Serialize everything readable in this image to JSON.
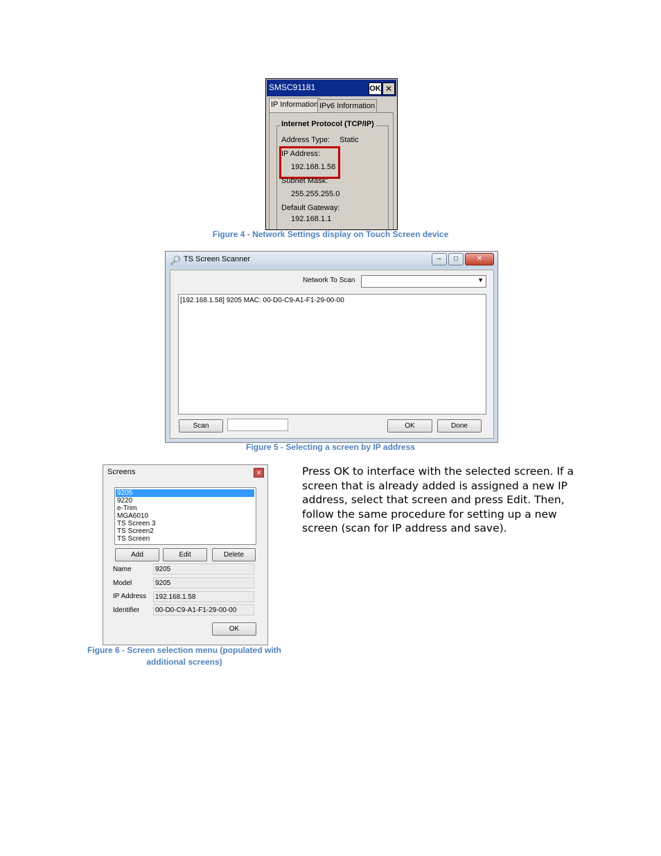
{
  "figure4": {
    "window_title": "SMSC91181",
    "ok_label": "OK",
    "close_label": "✕",
    "tabs": [
      "IP Information",
      "IPv6 Information"
    ],
    "group_title": "Internet Protocol (TCP/IP)",
    "address_type_label": "Address Type:",
    "address_type_value": "Static",
    "ip_address_label": "IP Address:",
    "ip_address_value": "192.168.1.58",
    "subnet_label": "Subnet Mask:",
    "subnet_value": "255.255.255.0",
    "gateway_label": "Default Gateway:",
    "gateway_value": "192.168.1.1",
    "caption": "Figure 4 - Network Settings display on Touch Screen device",
    "highlight_color": "#c00000"
  },
  "figure5": {
    "window_title": "TS Screen Scanner",
    "network_label": "Network To Scan",
    "network_value": "",
    "list_rows": [
      "[192.168.1.58] 9205 MAC: 00-D0-C9-A1-F1-29-00-00"
    ],
    "scan_label": "Scan",
    "ok_label": "OK",
    "done_label": "Done",
    "caption": "Figure 5 - Selecting a screen by IP address"
  },
  "figure6": {
    "window_title": "Screens",
    "screens": [
      "9205",
      "9220",
      "e-Trim",
      "MGA6010",
      "TS Screen 3",
      "TS Screen2",
      "TS Screen"
    ],
    "selected_index": 0,
    "add_label": "Add",
    "edit_label": "Edit",
    "delete_label": "Delete",
    "name_label": "Name",
    "name_value": "9205",
    "model_label": "Model",
    "model_value": "9205",
    "ip_label": "IP Address",
    "ip_value": "192.168.1.58",
    "identifier_label": "Identifier",
    "identifier_value": "00-D0-C9-A1-F1-29-00-00",
    "ok_label": "OK",
    "caption_line1": "Figure 6 - Screen selection menu (populated with",
    "caption_line2": "additional screens)"
  },
  "paragraph": {
    "part1": "Press ",
    "ok_word": "OK",
    "part2": " to interface with the selected screen.  If a screen that is already added is assigned a new IP address, select that screen and press ",
    "edit_word": "Edit.",
    "part3": "  Then, follow the same procedure for setting up a new screen (scan for IP address and save)."
  },
  "colors": {
    "caption": "#4f81bd",
    "selection": "#3399ff"
  }
}
